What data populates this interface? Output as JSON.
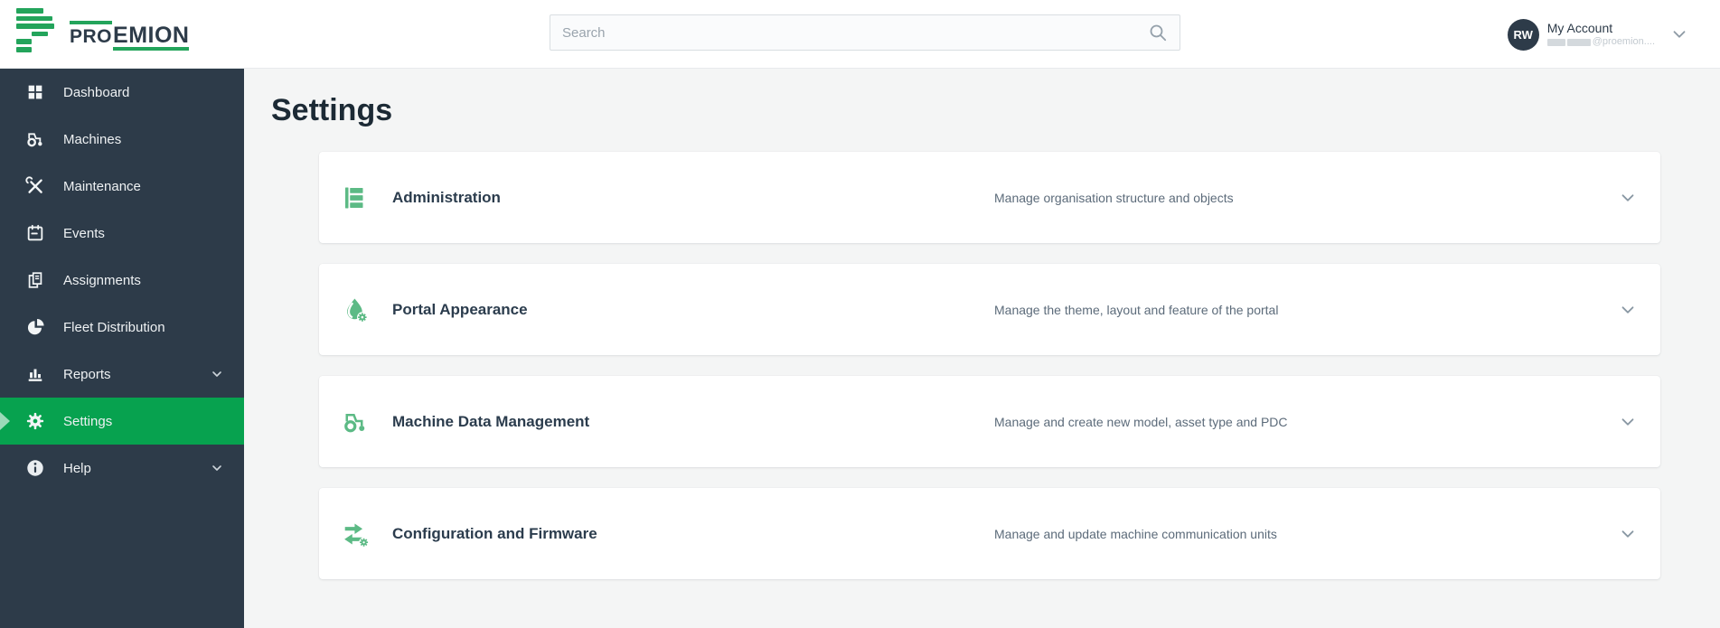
{
  "brand": {
    "pro": "PRO",
    "emion": "EMION"
  },
  "topbar": {
    "search_placeholder": "Search",
    "account": {
      "initials": "RW",
      "label": "My Account",
      "email_suffix": "@proemion...."
    }
  },
  "sidebar": {
    "items": [
      {
        "label": "Dashboard",
        "icon": "dashboard-grid-icon",
        "active": false,
        "expandable": false
      },
      {
        "label": "Machines",
        "icon": "tractor-icon",
        "active": false,
        "expandable": false
      },
      {
        "label": "Maintenance",
        "icon": "tools-icon",
        "active": false,
        "expandable": false
      },
      {
        "label": "Events",
        "icon": "calendar-icon",
        "active": false,
        "expandable": false
      },
      {
        "label": "Assignments",
        "icon": "documents-icon",
        "active": false,
        "expandable": false
      },
      {
        "label": "Fleet Distribution",
        "icon": "pie-chart-icon",
        "active": false,
        "expandable": false
      },
      {
        "label": "Reports",
        "icon": "bar-chart-icon",
        "active": false,
        "expandable": true
      },
      {
        "label": "Settings",
        "icon": "gear-icon",
        "active": true,
        "expandable": false
      },
      {
        "label": "Help",
        "icon": "info-icon",
        "active": false,
        "expandable": true
      }
    ]
  },
  "page": {
    "title": "Settings"
  },
  "cards": [
    {
      "title": "Administration",
      "description": "Manage organisation structure and objects",
      "icon": "org-structure-icon"
    },
    {
      "title": "Portal Appearance",
      "description": "Manage the theme, layout and feature of the portal",
      "icon": "theme-drop-gear-icon"
    },
    {
      "title": "Machine Data Management",
      "description": "Manage and create new model, asset type and PDC",
      "icon": "tractor-icon"
    },
    {
      "title": "Configuration and Firmware",
      "description": "Manage and update machine communication units",
      "icon": "transfer-arrows-gear-icon"
    }
  ],
  "colors": {
    "brand_green": "#23a45b",
    "active_green": "#07a24f",
    "sidebar_bg": "#2d3b49",
    "card_icon_green": "#5cba85"
  }
}
